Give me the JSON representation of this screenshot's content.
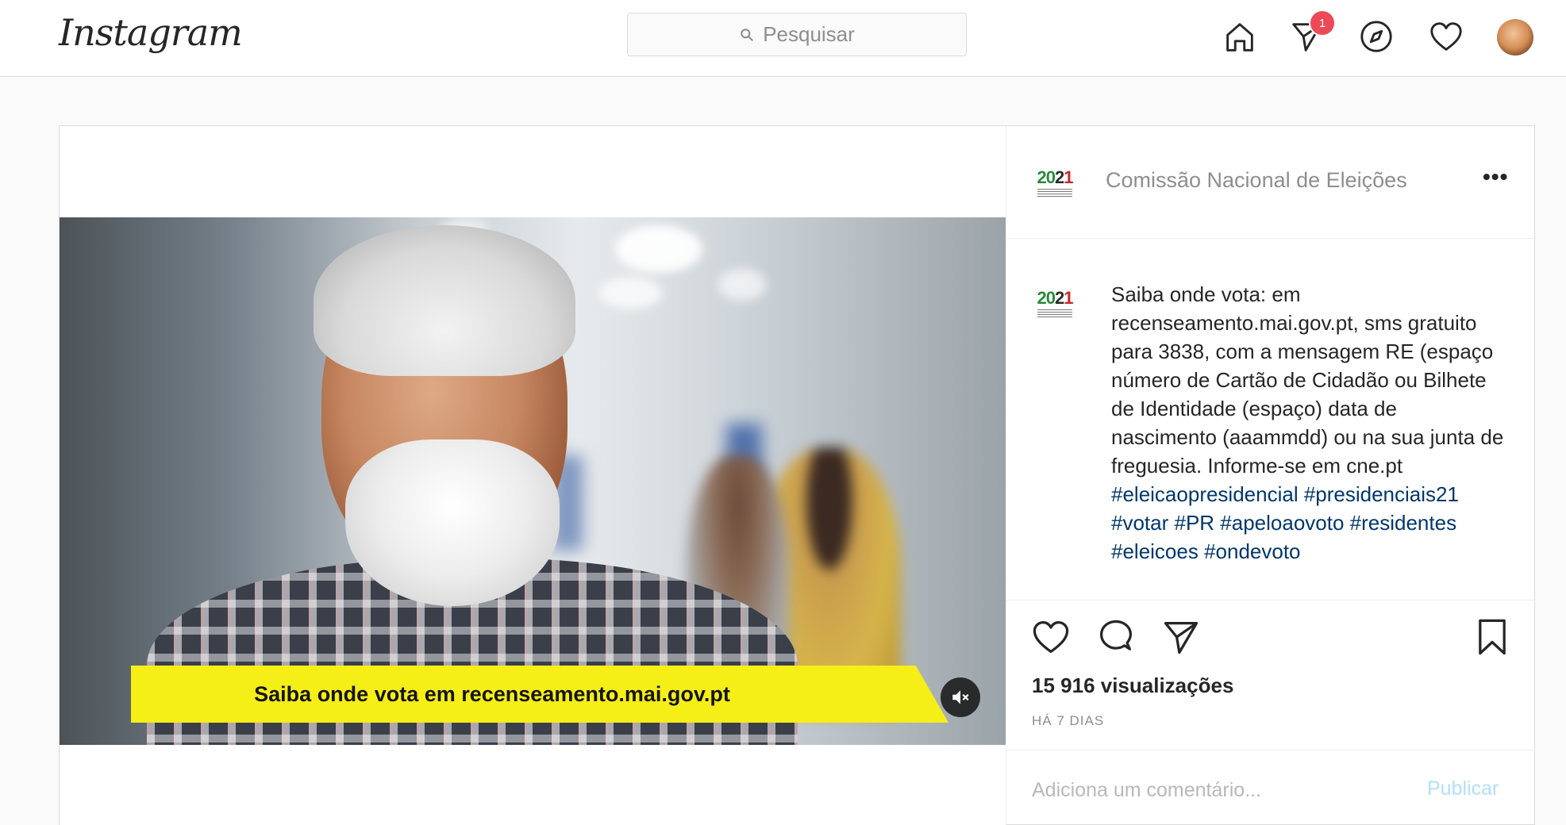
{
  "app": {
    "logo_text": "Instagram"
  },
  "search": {
    "placeholder": "Pesquisar"
  },
  "nav": {
    "icons": [
      "home-icon",
      "direct-icon",
      "explore-icon",
      "activity-icon"
    ],
    "direct_badge": "1"
  },
  "post": {
    "account_name": "Comissão Nacional de Eleições",
    "logo_year_parts": [
      "20",
      "2",
      "1"
    ],
    "more_label": "•••",
    "video_caption": "Saiba onde vota em recenseamento.mai.gov.pt",
    "caption_text": "Saiba onde vota: em recenseamento.mai.gov.pt, sms gratuito para 3838, com a mensagem RE (espaço número de Cartão de Cidadão ou Bilhete de Identidade (espaço) data de nascimento (aaammdd) ou na sua junta de freguesia. Informe-se em cne.pt",
    "hashtags": "#eleicaopresidencial #presidenciais21 #votar #PR #apeloaovoto #residentes #eleicoes #ondevoto",
    "views": "15 916 visualizações",
    "date": "HÁ 7 DIAS",
    "comment_placeholder": "Adiciona um comentário...",
    "publish_label": "Publicar"
  },
  "colors": {
    "link": "#00376b",
    "publish_disabled": "#b2dffc",
    "badge": "#ed4956",
    "video_band": "#f6ee17"
  }
}
